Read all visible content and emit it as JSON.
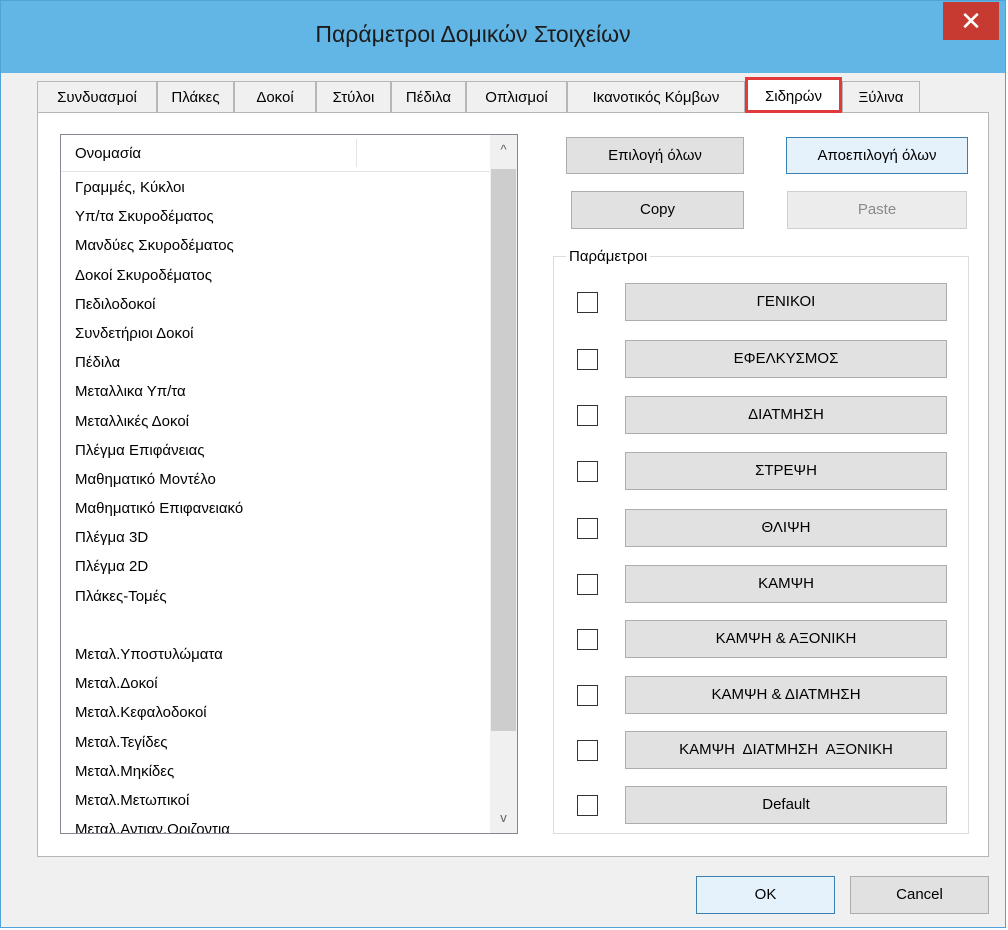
{
  "window": {
    "title": "Παράμετροι Δομικών Στοιχείων",
    "close_glyph": "✕"
  },
  "tabs": [
    {
      "label": "Συνδυασμοί"
    },
    {
      "label": "Πλάκες"
    },
    {
      "label": "Δοκοί"
    },
    {
      "label": "Στύλοι"
    },
    {
      "label": "Πέδιλα"
    },
    {
      "label": "Οπλισμοί"
    },
    {
      "label": "Ικανοτικός Κόμβων"
    },
    {
      "label": "Σιδηρών",
      "active": true
    },
    {
      "label": "Ξύλινα"
    }
  ],
  "list": {
    "header": "Ονομασία",
    "items": [
      "Γραμμές, Κύκλοι",
      "Υπ/τα Σκυροδέματος",
      "Μανδύες Σκυροδέματος",
      "Δοκοί Σκυροδέματος",
      "Πεδιλοδοκοί",
      "Συνδετήριοι Δοκοί",
      "Πέδιλα",
      "Μεταλλικα Υπ/τα",
      "Μεταλλικές Δοκοί",
      "Πλέγμα Επιφάνειας",
      "Μαθηματικό Μοντέλο",
      "Μαθηματικό Επιφανειακό",
      "Πλέγμα 3D",
      "Πλέγμα 2D",
      "Πλάκες-Τομές",
      "",
      "Μεταλ.Υποστυλώματα",
      "Μεταλ.Δοκοί",
      "Μεταλ.Κεφαλοδοκοί",
      "Μεταλ.Τεγίδες",
      "Μεταλ.Μηκίδες",
      "Μεταλ.Μετωπικοί",
      "Μεταλ.Αντιαν.Οριζοντια"
    ],
    "scroll_up_glyph": "^",
    "scroll_down_glyph": "v"
  },
  "buttons": {
    "select_all": "Επιλογή όλων",
    "deselect_all": "Αποεπιλογή όλων",
    "copy": "Copy",
    "paste": "Paste",
    "ok": "OK",
    "cancel": "Cancel"
  },
  "params": {
    "label": "Παράμετροι",
    "items": [
      {
        "label": "ΓΕΝΙΚΟΙ",
        "checked": false
      },
      {
        "label": "ΕΦΕΛΚΥΣΜΟΣ",
        "checked": false
      },
      {
        "label": "ΔΙΑΤΜΗΣΗ",
        "checked": false
      },
      {
        "label": "ΣΤΡΕΨΗ",
        "checked": false
      },
      {
        "label": "ΘΛΙΨΗ",
        "checked": false
      },
      {
        "label": "ΚΑΜΨΗ",
        "checked": false
      },
      {
        "label": "ΚΑΜΨΗ & ΑΞΟΝΙΚΗ",
        "checked": false
      },
      {
        "label": "ΚΑΜΨΗ & ΔΙΑΤΜΗΣΗ",
        "checked": false
      },
      {
        "label": "ΚΑΜΨΗ  ΔΙΑΤΜΗΣΗ  ΑΞΟΝΙΚΗ",
        "checked": false
      },
      {
        "label": "Default",
        "checked": false
      }
    ]
  },
  "colors": {
    "titlebar": "#62b6e6",
    "close_button": "#c73a32",
    "active_tab_highlight": "#e03a3a"
  }
}
